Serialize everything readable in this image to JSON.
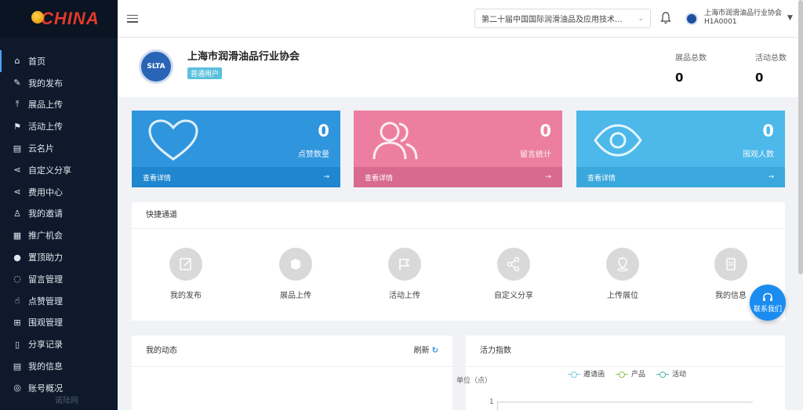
{
  "sidebar": {
    "logo": "CHINA",
    "watermark": "诺陆网",
    "items": [
      {
        "label": "首页",
        "icon": "home-icon",
        "glyph": "⌂"
      },
      {
        "label": "我的发布",
        "icon": "edit-icon",
        "glyph": "✎"
      },
      {
        "label": "展品上传",
        "icon": "upload-icon",
        "glyph": "⤒"
      },
      {
        "label": "活动上传",
        "icon": "flag-icon",
        "glyph": "⚑"
      },
      {
        "label": "云名片",
        "icon": "card-icon",
        "glyph": "▤"
      },
      {
        "label": "自定义分享",
        "icon": "share-icon",
        "glyph": "⋖"
      },
      {
        "label": "费用中心",
        "icon": "share-icon",
        "glyph": "⋖"
      },
      {
        "label": "我的邀请",
        "icon": "users-icon",
        "glyph": "♙"
      },
      {
        "label": "推广机会",
        "icon": "promo-icon",
        "glyph": "▦"
      },
      {
        "label": "置顶助力",
        "icon": "pin-icon",
        "glyph": "●"
      },
      {
        "label": "留言管理",
        "icon": "message-icon",
        "glyph": "◌"
      },
      {
        "label": "点赞管理",
        "icon": "thumb-icon",
        "glyph": "☝"
      },
      {
        "label": "围观管理",
        "icon": "watch-icon",
        "glyph": "⊞"
      },
      {
        "label": "分享记录",
        "icon": "record-icon",
        "glyph": "▯"
      },
      {
        "label": "我的信息",
        "icon": "info-icon",
        "glyph": "▤"
      },
      {
        "label": "账号概况",
        "icon": "account-icon",
        "glyph": "◎"
      }
    ]
  },
  "header": {
    "expo_select": "第二十届中国国际润滑油品及应用技术...",
    "org_name": "上海市润滑油品行业协会",
    "org_id": "H1A0001"
  },
  "profile": {
    "logo_text": "SLTA",
    "name": "上海市润滑油品行业协会",
    "badge": "普通用户",
    "stats": [
      {
        "label": "展品总数",
        "value": "0"
      },
      {
        "label": "活动总数",
        "value": "0"
      }
    ]
  },
  "cards": [
    {
      "value": "0",
      "label": "点赞数量",
      "link": "查看详情",
      "arrow": "→",
      "color": "#2f95dd"
    },
    {
      "value": "0",
      "label": "留言统计",
      "link": "查看详情",
      "arrow": "→",
      "color": "#ec7fa1"
    },
    {
      "value": "0",
      "label": "围观人数",
      "link": "查看详情",
      "arrow": "→",
      "color": "#4db8ea"
    }
  ],
  "quick": {
    "title": "快捷通道",
    "items": [
      {
        "label": "我的发布",
        "icon": "edit-icon"
      },
      {
        "label": "展品上传",
        "icon": "box-icon"
      },
      {
        "label": "活动上传",
        "icon": "flag-icon"
      },
      {
        "label": "自定义分享",
        "icon": "share-icon"
      },
      {
        "label": "上传展位",
        "icon": "location-icon"
      },
      {
        "label": "我的信息",
        "icon": "id-card-icon"
      }
    ]
  },
  "contact": {
    "label": "联系我们"
  },
  "activity": {
    "title": "我的动态",
    "refresh": "刷新"
  },
  "vitality": {
    "title": "活力指数",
    "legend": [
      {
        "name": "邀请函",
        "color": "#7ec8e3"
      },
      {
        "name": "产品",
        "color": "#8bc34a"
      },
      {
        "name": "活动",
        "color": "#4db6ac"
      }
    ],
    "unit": "单位（点）",
    "ytick": "1"
  }
}
